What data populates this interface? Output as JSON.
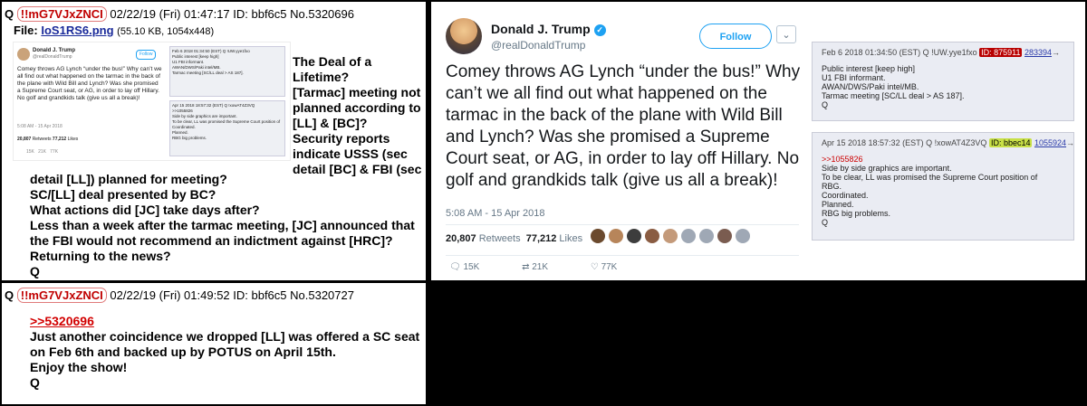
{
  "post1": {
    "q": "Q",
    "trip": "!!mG7VJxZNCI",
    "meta": "02/22/19 (Fri) 01:47:17 ID: bbf6c5 No.5320696",
    "file_label": "File:",
    "file_name": "IoS1RS6.png",
    "file_info": "(55.10 KB, 1054x448)",
    "side_lines": [
      "The Deal of a",
      "Lifetime?",
      "[Tarmac] meeting not",
      "planned according to",
      "[LL] & [BC]?",
      "Security reports",
      "indicate USSS (sec",
      "detail [BC] & FBI (sec"
    ],
    "body_lines": [
      "detail [LL]) planned for meeting?",
      "SC/[LL] deal presented by BC?",
      "What actions did [JC] take days after?",
      "Less than a week after the tarmac meeting, [JC] announced that",
      "the FBI would not recommend an indictment against [HRC]?",
      "Returning to the news?",
      "Q"
    ]
  },
  "post2": {
    "q": "Q",
    "trip": "!!mG7VJxZNCI",
    "meta": "02/22/19 (Fri) 01:49:52 ID: bbf6c5 No.5320727",
    "reply_link": ">>5320696",
    "body_lines": [
      "Just another coincidence we dropped [LL] was offered a SC seat",
      "on Feb 6th and backed up by POTUS on April 15th.",
      "Enjoy the show!",
      "Q"
    ]
  },
  "tweet": {
    "name": "Donald J. Trump",
    "verified_icon": "verified-icon",
    "handle": "@realDonaldTrump",
    "follow_label": "Follow",
    "text": "Comey throws AG Lynch “under the bus!” Why can’t we all find out what happened on the tarmac in the back of the plane with Wild Bill and Lynch? Was she promised a Supreme Court seat, or AG, in order to lay off Hillary. No golf and grandkids talk (give us all a break)!",
    "time": "5:08 AM - 15 Apr 2018",
    "retweets_count": "20,807",
    "retweets_label": "Retweets",
    "likes_count": "77,212",
    "likes_label": "Likes",
    "avatar_colors": [
      "#6b4a2e",
      "#b7855a",
      "#3d3d3d",
      "#8a5c42",
      "#c49a7a",
      "#9fa8b5",
      "#9fa8b5",
      "#7a5c50",
      "#9fa8b5"
    ],
    "replies": "15K",
    "retweets_short": "21K",
    "likes_short": "77K"
  },
  "qpost1": {
    "header": "Feb 6 2018 01:34:50 (EST) Q !UW.yye1fxo",
    "id": "ID: 875911",
    "link": "283394",
    "lines": [
      "Public interest [keep high]",
      "U1 FBI informant.",
      "AWAN/DWS/Paki intel/MB.",
      "Tarmac meeting [SC/LL deal > AS 187].",
      "Q"
    ]
  },
  "qpost2": {
    "header": "Apr 15 2018 18:57:32 (EST) Q !xowAT4Z3VQ",
    "id": "ID: bbec14",
    "link": "1055924",
    "reply": ">>1055826",
    "lines": [
      "Side by side graphics are important.",
      "To be clear, LL was promised the Supreme Court position of",
      "RBG.",
      "Coordinated.",
      "Planned.",
      "RBG big problems.",
      "Q"
    ]
  }
}
